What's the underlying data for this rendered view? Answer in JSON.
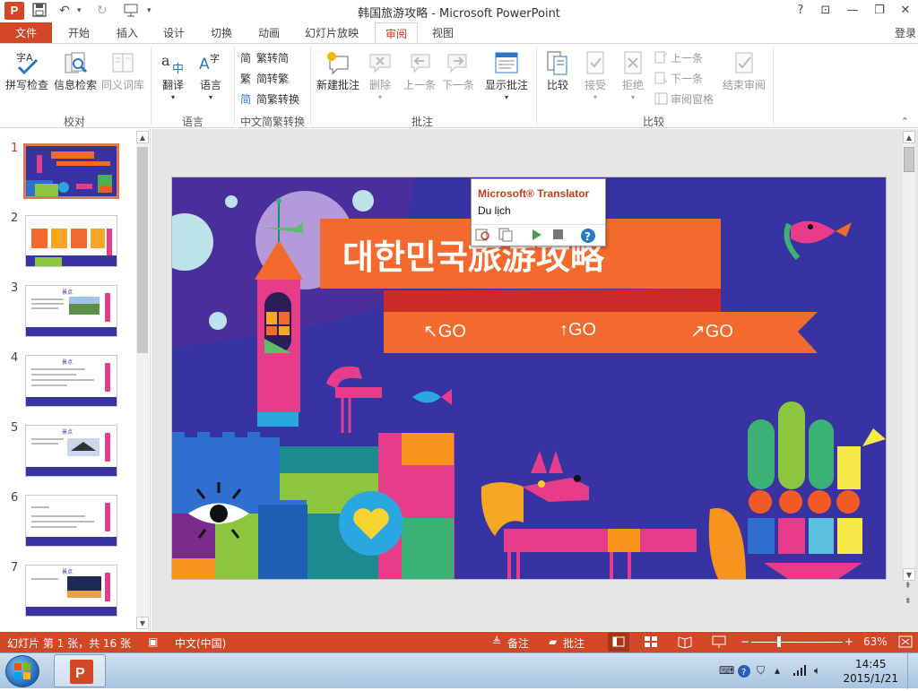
{
  "titlebar": {
    "title": "韩国旅游攻略 - Microsoft PowerPoint",
    "app_logo": "P",
    "help": "?",
    "restore_ribbon": "⊡",
    "minimize": "—",
    "maximize": "❐",
    "close": "✕"
  },
  "tabs": [
    {
      "label": "文件"
    },
    {
      "label": "开始"
    },
    {
      "label": "插入"
    },
    {
      "label": "设计"
    },
    {
      "label": "切换"
    },
    {
      "label": "动画"
    },
    {
      "label": "幻灯片放映"
    },
    {
      "label": "审阅"
    },
    {
      "label": "视图"
    }
  ],
  "signin": "登录",
  "ribbon": {
    "proofing": {
      "spelling": "拼写检查",
      "research": "信息检索",
      "thesaurus": "同义词库",
      "group": "校对"
    },
    "language": {
      "translate": "翻译",
      "language": "语言",
      "group": "语言"
    },
    "chinese": {
      "to_simplified": "繁转简",
      "to_traditional": "简转繁",
      "convert": "简繁转换",
      "group": "中文简繁转换"
    },
    "comments": {
      "new": "新建批注",
      "delete": "删除",
      "prev": "上一条",
      "next": "下一条",
      "show": "显示批注",
      "group": "批注"
    },
    "compare": {
      "compare": "比较",
      "accept": "接受",
      "reject": "拒绝",
      "prev": "上一条",
      "next": "下一条",
      "pane": "审阅窗格",
      "end": "结束审阅",
      "group": "比较"
    }
  },
  "thumbnails": {
    "numbers": [
      "1",
      "2",
      "3",
      "4",
      "5",
      "6",
      "7"
    ],
    "selected": "1",
    "labels": [
      "景点",
      "景点",
      "景点",
      "景点"
    ]
  },
  "slide": {
    "title": "대한민국旅游攻略",
    "go_buttons": [
      "↖GO",
      "↑GO",
      "↗GO"
    ]
  },
  "tooltip": {
    "title": "Microsoft® Translator",
    "translation": "Du lịch"
  },
  "statusbar": {
    "slide_info": "幻灯片 第 1 张，共 16 张",
    "language": "中文(中国)",
    "notes": "备注",
    "comments": "批注",
    "zoom": "63%"
  },
  "taskbar": {
    "time": "14:45",
    "date": "2015/1/21"
  },
  "colors": {
    "accent": "#d24726",
    "slide_bg": "#3733a3",
    "banner_orange": "#f26a2d"
  }
}
